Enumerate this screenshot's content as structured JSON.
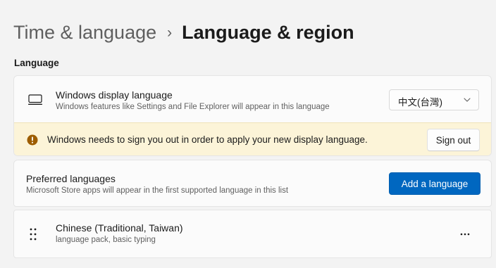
{
  "breadcrumb": {
    "parent": "Time & language",
    "separator": "›",
    "current": "Language & region"
  },
  "section": {
    "language_label": "Language"
  },
  "display_language": {
    "title": "Windows display language",
    "description": "Windows features like Settings and File Explorer will appear in this language",
    "selected_value": "中文(台灣)",
    "icon": "monitor-icon"
  },
  "warning": {
    "message": "Windows needs to sign you out in order to apply your new display language.",
    "button_label": "Sign out",
    "icon": "info-warning-icon",
    "color": "#9d5d00"
  },
  "preferred_languages": {
    "title": "Preferred languages",
    "description": "Microsoft Store apps will appear in the first supported language in this list",
    "button_label": "Add a language",
    "accent_color": "#0067c0"
  },
  "languages": [
    {
      "name": "Chinese (Traditional, Taiwan)",
      "features": "language pack, basic typing",
      "menu_icon": "more-options-icon"
    }
  ]
}
